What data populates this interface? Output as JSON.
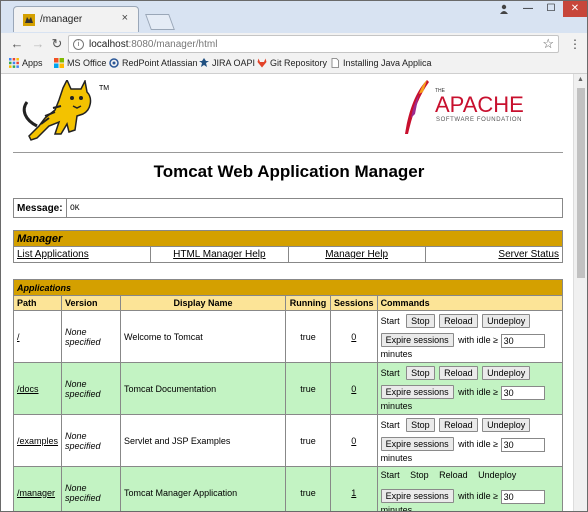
{
  "browser": {
    "tab_title": "/manager",
    "tab_close": "×",
    "url_host": "localhost",
    "url_path": ":8080/manager/html",
    "window_controls": {
      "minimize": "—",
      "maximize": "☐",
      "close": "✕"
    }
  },
  "bookmarks": [
    {
      "label": "Apps",
      "icon": "apps-grid-icon"
    },
    {
      "label": "MS Office",
      "icon": "ms-office-icon"
    },
    {
      "label": "RedPoint Atlassian",
      "icon": "redpoint-icon"
    },
    {
      "label": "JIRA OAPI",
      "icon": "jira-icon"
    },
    {
      "label": "Git Repository",
      "icon": "gitlab-icon"
    },
    {
      "label": "Installing Java Applica",
      "icon": "page-icon"
    }
  ],
  "page": {
    "tomcat_tm": "TM",
    "apache_small": "THE",
    "apache_word": "APACHE",
    "apache_sub": "SOFTWARE FOUNDATION",
    "title": "Tomcat Web Application Manager",
    "message_label": "Message:",
    "message_value": "OK",
    "manager": {
      "heading": "Manager",
      "links": [
        "List Applications",
        "HTML Manager Help",
        "Manager Help",
        "Server Status"
      ]
    },
    "applications": {
      "heading": "Applications",
      "columns": [
        "Path",
        "Version",
        "Display Name",
        "Running",
        "Sessions",
        "Commands"
      ],
      "start": "Start",
      "stop": "Stop",
      "reload": "Reload",
      "undeploy": "Undeploy",
      "expire": "Expire sessions",
      "with_idle": "with idle ≥",
      "idle_value": "30",
      "minutes": "minutes",
      "rows": [
        {
          "path": "/",
          "version": "None specified",
          "display_name": "Welcome to Tomcat",
          "running": "true",
          "sessions": "0"
        },
        {
          "path": "/docs",
          "version": "None specified",
          "display_name": "Tomcat Documentation",
          "running": "true",
          "sessions": "0"
        },
        {
          "path": "/examples",
          "version": "None specified",
          "display_name": "Servlet and JSP Examples",
          "running": "true",
          "sessions": "0"
        },
        {
          "path": "/manager",
          "version": "None specified",
          "display_name": "Tomcat Manager Application",
          "running": "true",
          "sessions": "1"
        }
      ]
    }
  },
  "colors": {
    "section_header": "#d4a000",
    "column_header": "#fce497",
    "row_green": "#c3f3c3",
    "apache_red": "#c8102e"
  }
}
